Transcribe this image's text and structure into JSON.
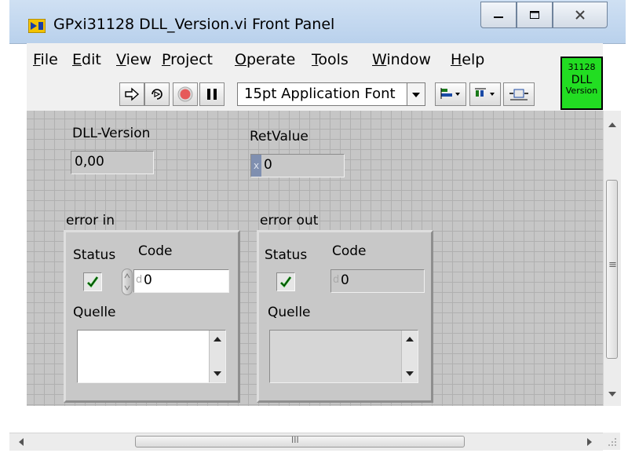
{
  "window": {
    "title": "GPxi31128 DLL_Version.vi Front Panel",
    "controls": [
      "minimize",
      "maximize",
      "close"
    ]
  },
  "menu": {
    "items": [
      "File",
      "Edit",
      "View",
      "Project",
      "Operate",
      "Tools",
      "Window",
      "Help"
    ]
  },
  "toolbar": {
    "font_select": "15pt Application Font",
    "icons": [
      "run-arrow-icon",
      "run-continuously-icon",
      "abort-icon",
      "pause-icon",
      "align-icon",
      "distribute-icon",
      "resize-icon"
    ]
  },
  "vi_icon": {
    "line1": "31128",
    "line2": "DLL",
    "line3": "Version",
    "color": "#22dd22"
  },
  "panel": {
    "dll_version": {
      "label": "DLL-Version",
      "value": "0,00"
    },
    "ret_value": {
      "label": "RetValue",
      "radix": "x",
      "value": "0"
    },
    "error_in": {
      "label": "error in",
      "status_label": "Status",
      "code_label": "Code",
      "radix": "d",
      "code_value": "0",
      "source_label": "Quelle",
      "source_value": ""
    },
    "error_out": {
      "label": "error out",
      "status_label": "Status",
      "code_label": "Code",
      "radix": "d",
      "code_value": "0",
      "source_label": "Quelle",
      "source_value": ""
    }
  },
  "scrollbar": {
    "h_grip": "III",
    "v_grip": "≡"
  }
}
